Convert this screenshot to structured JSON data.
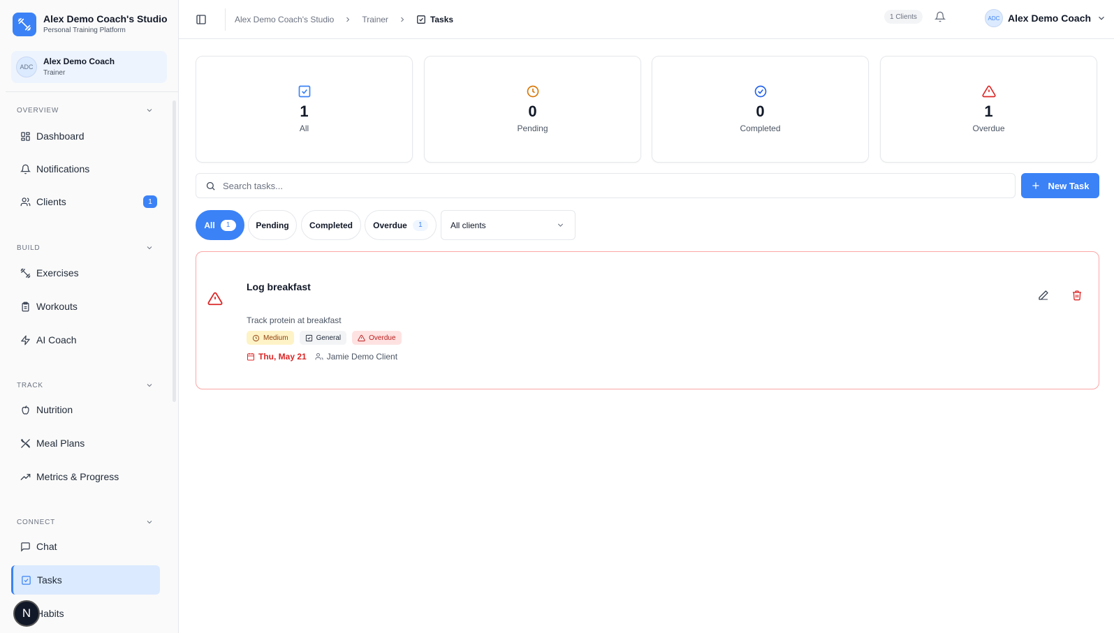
{
  "brand": {
    "title": "Alex Demo Coach's Studio",
    "subtitle": "Personal Training Platform"
  },
  "user_card": {
    "initials": "ADC",
    "name": "Alex Demo Coach",
    "role": "Trainer"
  },
  "nav": {
    "overview_title": "OVERVIEW",
    "build_title": "BUILD",
    "track_title": "TRACK",
    "connect_title": "CONNECT",
    "dashboard": "Dashboard",
    "notifications": "Notifications",
    "clients": "Clients",
    "clients_badge": "1",
    "exercises": "Exercises",
    "workouts": "Workouts",
    "ai_coach": "AI Coach",
    "nutrition": "Nutrition",
    "meal_plans": "Meal Plans",
    "metrics": "Metrics & Progress",
    "chat": "Chat",
    "tasks": "Tasks",
    "habits": "Habits"
  },
  "fab": {
    "letter": "N"
  },
  "header": {
    "breadcrumb": [
      "Alex Demo Coach's Studio",
      "Trainer",
      "Tasks"
    ],
    "clients_count": "1 Clients",
    "user_initials": "ADC",
    "user_name": "Alex Demo Coach"
  },
  "stats": [
    {
      "value": "1",
      "label": "All",
      "icon": "check-square-icon",
      "color": "#3b82f6"
    },
    {
      "value": "0",
      "label": "Pending",
      "icon": "clock-icon",
      "color": "#d97706"
    },
    {
      "value": "0",
      "label": "Completed",
      "icon": "check-circle-icon",
      "color": "#2563eb"
    },
    {
      "value": "1",
      "label": "Overdue",
      "icon": "alert-triangle-icon",
      "color": "#dc2626"
    }
  ],
  "search": {
    "placeholder": "Search tasks...",
    "value": ""
  },
  "new_task_label": "New Task",
  "filters": {
    "all": "All",
    "all_count": "1",
    "pending": "Pending",
    "completed": "Completed",
    "overdue": "Overdue",
    "overdue_count": "1",
    "client_select": "All clients"
  },
  "task": {
    "title": "Log breakfast",
    "description": "Track protein at breakfast",
    "priority": "Medium",
    "category": "General",
    "status": "Overdue",
    "due": "Thu, May 21",
    "assignee": "Jamie Demo Client"
  },
  "colors": {
    "accent": "#3b82f6",
    "danger": "#dc2626",
    "warning": "#d97706"
  }
}
